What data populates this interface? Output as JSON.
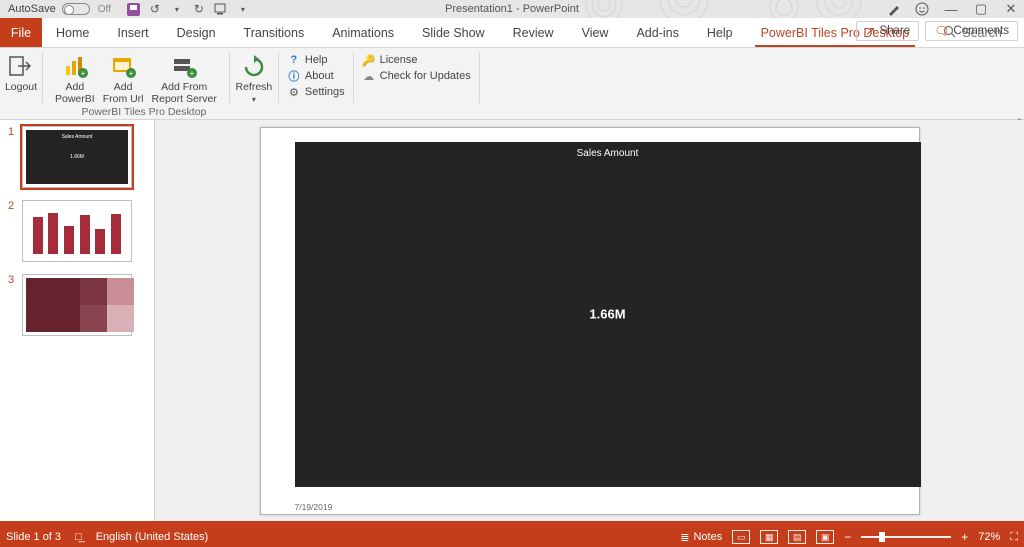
{
  "titlebar": {
    "autosave": "AutoSave",
    "autosave_state": "Off",
    "title": "Presentation1  -  PowerPoint"
  },
  "win": {
    "min": "—",
    "max": "▢",
    "close": "✕"
  },
  "tabs": {
    "file": "File",
    "items": [
      "Home",
      "Insert",
      "Design",
      "Transitions",
      "Animations",
      "Slide Show",
      "Review",
      "View",
      "Add-ins",
      "Help",
      "PowerBI Tiles Pro Desktop"
    ],
    "active_index": 10,
    "search_placeholder": "Search",
    "share": "Share",
    "comments": "Comments"
  },
  "ribbon": {
    "logout": "Logout",
    "add_powerbi": "Add\nPowerBI",
    "add_from_url": "Add\nFrom Url",
    "add_from_rs": "Add From\nReport Server",
    "refresh": "Refresh",
    "help": "Help",
    "about": "About",
    "settings": "Settings",
    "license": "License",
    "check_updates": "Check for Updates",
    "group_label": "PowerBI Tiles Pro Desktop"
  },
  "thumbs": {
    "items": [
      {
        "n": "1"
      },
      {
        "n": "2"
      },
      {
        "n": "3"
      }
    ]
  },
  "slide": {
    "tile_title": "Sales Amount",
    "tile_value": "1.66M",
    "datestamp": "7/19/2019"
  },
  "status": {
    "slide_of": "Slide 1 of 3",
    "lang": "English (United States)",
    "notes": "Notes",
    "zoom": "72%"
  }
}
